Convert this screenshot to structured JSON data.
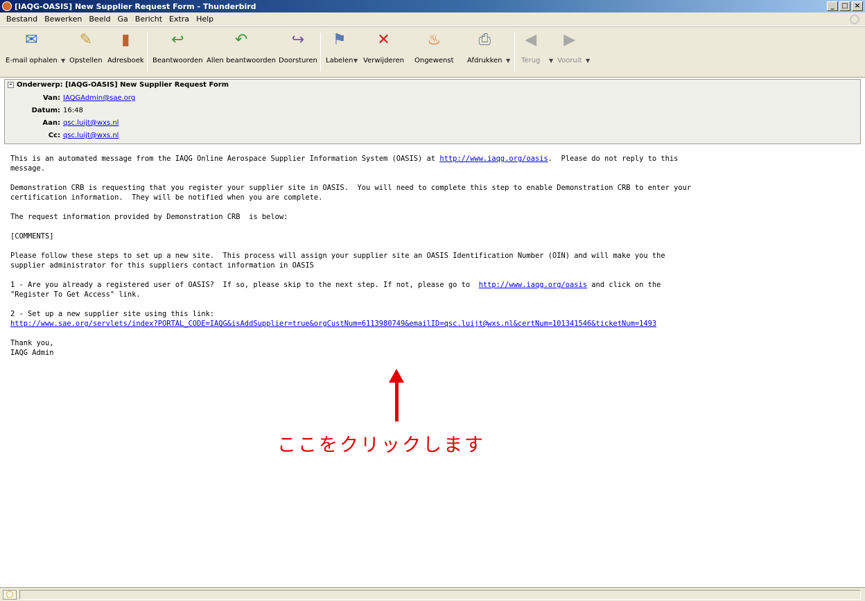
{
  "window": {
    "title": "[IAQG-OASIS] New Supplier Request Form - Thunderbird",
    "controls": [
      "_",
      "□",
      "×"
    ]
  },
  "menubar": {
    "items": [
      "Bestand",
      "Bewerken",
      "Beeld",
      "Ga",
      "Bericht",
      "Extra",
      "Help"
    ]
  },
  "toolbar": {
    "buttons": [
      {
        "label": "E-mail ophalen",
        "icon": "get-mail-icon"
      },
      {
        "label": "Opstellen",
        "icon": "compose-icon"
      },
      {
        "label": "Adresboek",
        "icon": "address-book-icon"
      },
      {
        "label": "Beantwoorden",
        "icon": "reply-icon"
      },
      {
        "label": "Allen beantwoorden",
        "icon": "reply-all-icon"
      },
      {
        "label": "Doorsturen",
        "icon": "forward-icon"
      },
      {
        "label": "Labelen",
        "icon": "tag-icon"
      },
      {
        "label": "Verwijderen",
        "icon": "delete-icon"
      },
      {
        "label": "Ongewenst",
        "icon": "junk-icon"
      },
      {
        "label": "Afdrukken",
        "icon": "print-icon"
      },
      {
        "label": "Terug",
        "icon": "back-icon"
      },
      {
        "label": "Vooruit",
        "icon": "forward-nav-icon"
      }
    ]
  },
  "header": {
    "subject_label": "Onderwerp:",
    "subject_value": "[IAQG-OASIS] New Supplier Request Form",
    "from_label": "Van:",
    "from_value": "IAQGAdmin@sae.org",
    "date_label": "Datum:",
    "date_value": "16:48",
    "to_label": "Aan:",
    "to_value": "qsc.luijt@wxs.nl",
    "cc_label": "Cc:",
    "cc_value": "qsc.luijt@wxs.nl"
  },
  "body": {
    "p1_a": "This is an automated message from the IAQG Online Aerospace Supplier Information System (OASIS) at ",
    "p1_link": "http://www.iaqg.org/oasis",
    "p1_b": ".  Please do not reply to this\nmessage.",
    "p2": "Demonstration CRB is requesting that you register your supplier site in OASIS.  You will need to complete this step to enable Demonstration CRB to enter your\ncertification information.  They will be notified when you are complete.",
    "p3": "The request information provided by Demonstration CRB  is below:",
    "p4": "[COMMENTS]",
    "p5": "Please follow these steps to set up a new site.  This process will assign your supplier site an OASIS Identification Number (OIN) and will make you the\nsupplier administrator for this suppliers contact information in OASIS",
    "p6_a": "1 - Are you already a registered user of OASIS?  If so, please skip to the next step. If not, please go to  ",
    "p6_link": "http://www.iaqg.org/oasis",
    "p6_b": " and click on the\n\"Register To Get Access\" link.",
    "p7_a": "2 - Set up a new supplier site using this link:",
    "p7_link": "http://www.sae.org/servlets/index?PORTAL_CODE=IAQG&isAddSupplier=true&orgCustNum=6113980749&emailID=qsc.luijt@wxs.nl&certNum=101341546&ticketNum=1493",
    "p8": "Thank you,\nIAQG Admin"
  },
  "annotation": {
    "text": "ここをクリックします",
    "color": "#e00000"
  },
  "statusbar": {
    "text": ""
  }
}
